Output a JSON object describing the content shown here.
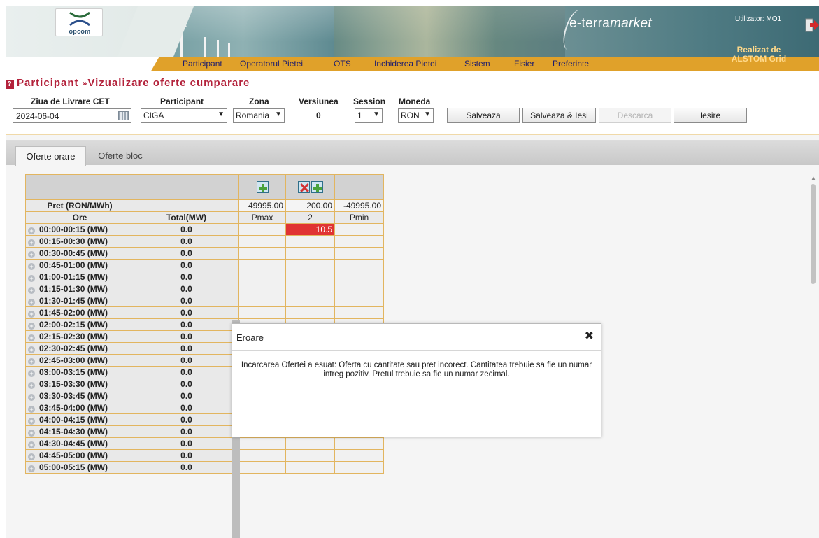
{
  "header": {
    "logo_text": "opcom",
    "brand_prefix": "e-terra",
    "brand_suffix": "market",
    "user_label": "Utilizator: MO1",
    "realizat_line1": "Realizat de",
    "realizat_line2": "ALSTOM Grid"
  },
  "menu": [
    "Participant",
    "Operatorul Pietei",
    "OTS",
    "Inchiderea Pietei",
    "Sistem",
    "Fisier",
    "Preferinte"
  ],
  "title": {
    "part1": "Participant",
    "separator": "»",
    "part2": "Vizualizare oferte cumparare"
  },
  "filters": {
    "date_label": "Ziua de Livrare CET",
    "date_value": "2024-06-04",
    "participant_label": "Participant",
    "participant_value": "CIGA",
    "zona_label": "Zona",
    "zona_value": "Romania",
    "versiunea_label": "Versiunea",
    "versiunea_value": "0",
    "session_label": "Session",
    "session_value": "1",
    "moneda_label": "Moneda",
    "moneda_value": "RON"
  },
  "buttons": {
    "salveaza": "Salveaza",
    "salveaza_iesi": "Salveaza & Iesi",
    "descarca": "Descarca",
    "iesire": "Iesire"
  },
  "tabs": [
    "Oferte orare",
    "Oferte bloc"
  ],
  "grid": {
    "price_label": "Pret (RON/MWh)",
    "ore_label": "Ore",
    "total_label": "Total(MW)",
    "prices": [
      "49995.00",
      "200.00",
      "-49995.00"
    ],
    "col_labels": [
      "Pmax",
      "2",
      "Pmin"
    ],
    "rows": [
      {
        "hour": "00:00-00:15 (MW)",
        "total": "0.0",
        "c2": "10.5"
      },
      {
        "hour": "00:15-00:30 (MW)",
        "total": "0.0",
        "c2": ""
      },
      {
        "hour": "00:30-00:45 (MW)",
        "total": "0.0",
        "c2": ""
      },
      {
        "hour": "00:45-01:00 (MW)",
        "total": "0.0",
        "c2": ""
      },
      {
        "hour": "01:00-01:15 (MW)",
        "total": "0.0",
        "c2": ""
      },
      {
        "hour": "01:15-01:30 (MW)",
        "total": "0.0",
        "c2": ""
      },
      {
        "hour": "01:30-01:45 (MW)",
        "total": "0.0",
        "c2": ""
      },
      {
        "hour": "01:45-02:00 (MW)",
        "total": "0.0",
        "c2": ""
      },
      {
        "hour": "02:00-02:15 (MW)",
        "total": "0.0",
        "c2": ""
      },
      {
        "hour": "02:15-02:30 (MW)",
        "total": "0.0",
        "c2": ""
      },
      {
        "hour": "02:30-02:45 (MW)",
        "total": "0.0",
        "c2": ""
      },
      {
        "hour": "02:45-03:00 (MW)",
        "total": "0.0",
        "c2": ""
      },
      {
        "hour": "03:00-03:15 (MW)",
        "total": "0.0",
        "c2": ""
      },
      {
        "hour": "03:15-03:30 (MW)",
        "total": "0.0",
        "c2": ""
      },
      {
        "hour": "03:30-03:45 (MW)",
        "total": "0.0",
        "c2": ""
      },
      {
        "hour": "03:45-04:00 (MW)",
        "total": "0.0",
        "c2": ""
      },
      {
        "hour": "04:00-04:15 (MW)",
        "total": "0.0",
        "c2": ""
      },
      {
        "hour": "04:15-04:30 (MW)",
        "total": "0.0",
        "c2": ""
      },
      {
        "hour": "04:30-04:45 (MW)",
        "total": "0.0",
        "c2": ""
      },
      {
        "hour": "04:45-05:00 (MW)",
        "total": "0.0",
        "c2": ""
      },
      {
        "hour": "05:00-05:15 (MW)",
        "total": "0.0",
        "c2": ""
      }
    ]
  },
  "dialog": {
    "title": "Eroare",
    "close_glyph": "✖",
    "message": "Incarcarea Ofertei a esuat: Oferta cu cantitate sau pret incorect. Cantitatea trebuie sa fie un numar intreg pozitiv. Pretul trebuie sa fie un numar zecimal."
  },
  "colors": {
    "menu_bar": "#e0a12a",
    "title_red": "#b3223b",
    "error_cell": "#e03333",
    "grid_border": "#e2b55f"
  }
}
